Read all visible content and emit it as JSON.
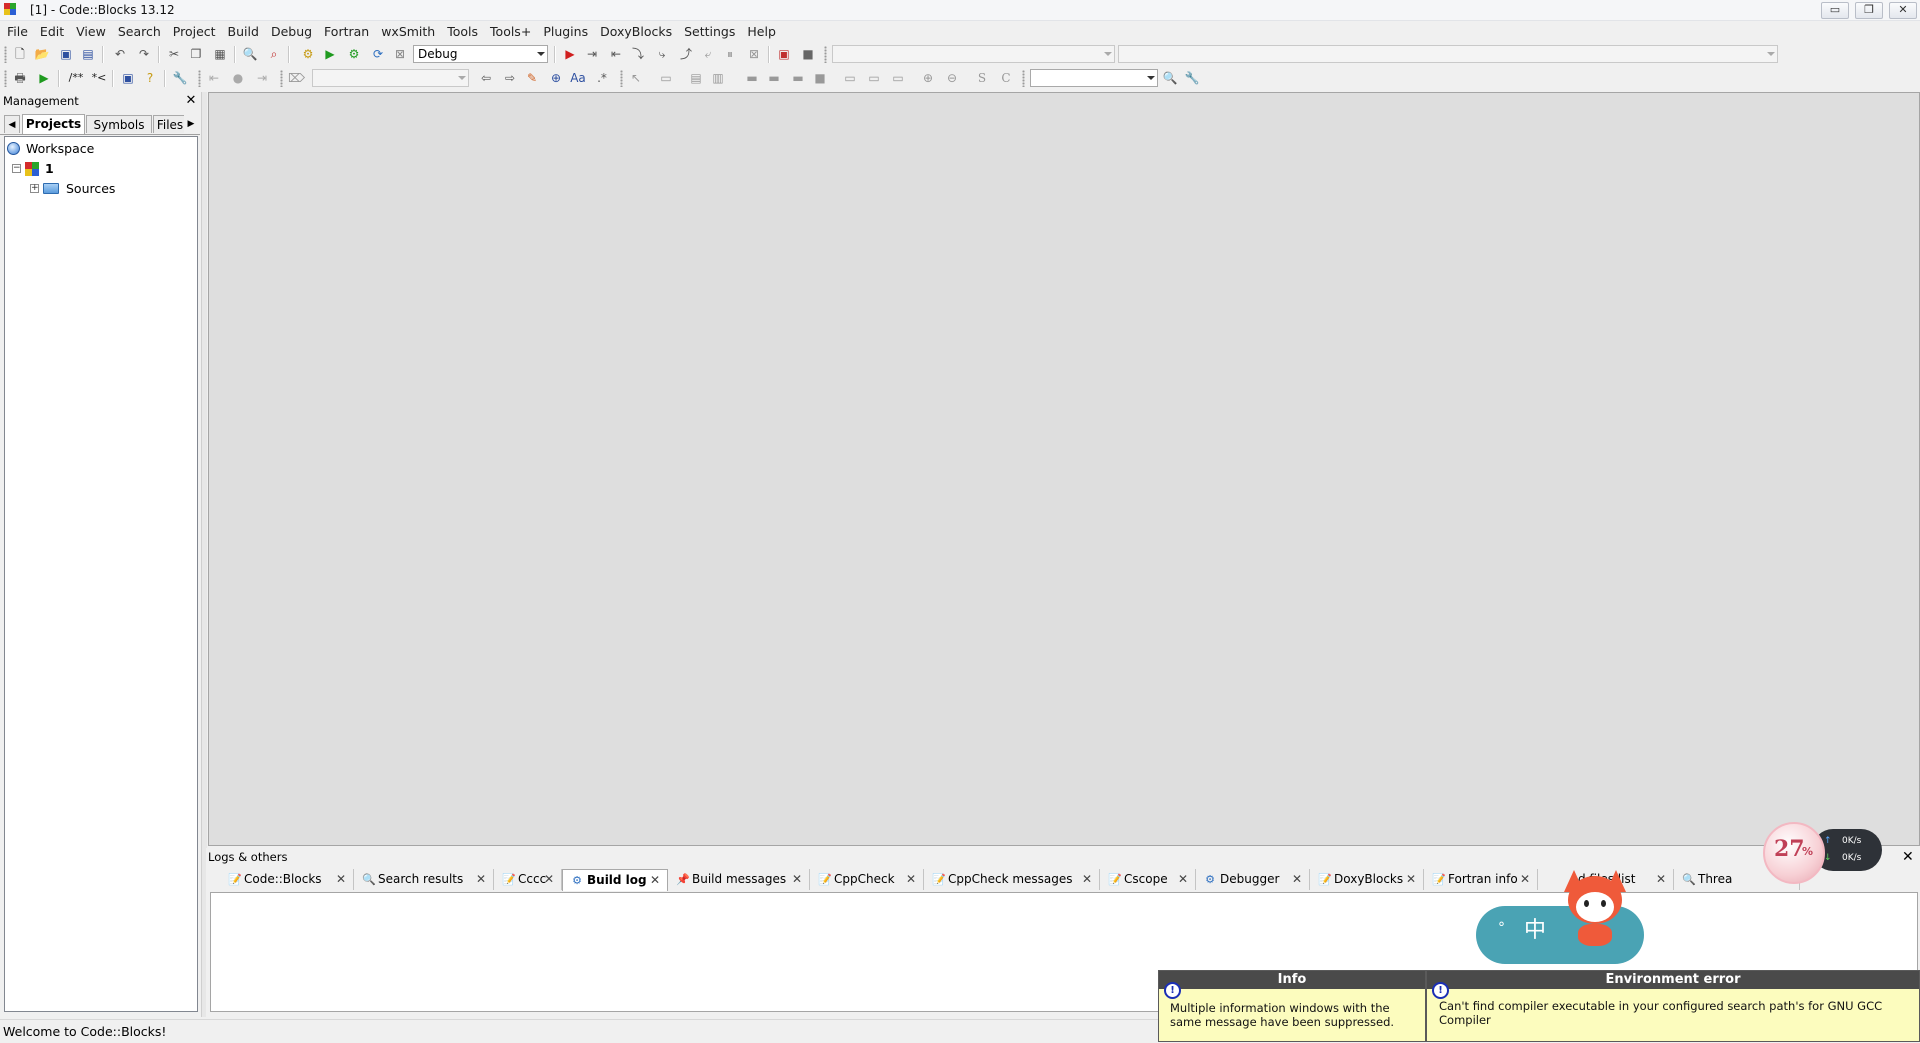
{
  "window": {
    "title": "[1] - Code::Blocks 13.12",
    "buttons": [
      "▭",
      "❐",
      "✕"
    ]
  },
  "menu": [
    "File",
    "Edit",
    "View",
    "Search",
    "Project",
    "Build",
    "Debug",
    "Fortran",
    "wxSmith",
    "Tools",
    "Tools+",
    "Plugins",
    "DoxyBlocks",
    "Settings",
    "Help"
  ],
  "toolbar": {
    "build_target": "Debug",
    "symbol_combo": "",
    "function_combo": "",
    "search_combo": "",
    "jump_combo": ""
  },
  "management": {
    "title": "Management",
    "tabs": [
      "Projects",
      "Symbols",
      "Files"
    ],
    "active_tab": "Projects",
    "tree": {
      "workspace": "Workspace",
      "project": "1",
      "folder": "Sources"
    }
  },
  "logs": {
    "title": "Logs & others",
    "tabs": [
      {
        "label": "Code::Blocks",
        "icon": "note-icon"
      },
      {
        "label": "Search results",
        "icon": "search-icon"
      },
      {
        "label": "Cccc",
        "icon": "note-icon"
      },
      {
        "label": "Build log",
        "icon": "gear-icon",
        "active": true
      },
      {
        "label": "Build messages",
        "icon": "pin-icon"
      },
      {
        "label": "CppCheck",
        "icon": "note-icon"
      },
      {
        "label": "CppCheck messages",
        "icon": "note-icon"
      },
      {
        "label": "Cscope",
        "icon": "note-icon"
      },
      {
        "label": "Debugger",
        "icon": "gear-icon"
      },
      {
        "label": "DoxyBlocks",
        "icon": "note-icon"
      },
      {
        "label": "Fortran info",
        "icon": "note-icon"
      },
      {
        "label": "d files list",
        "icon": ""
      },
      {
        "label": "Threa",
        "icon": "search-icon"
      }
    ]
  },
  "status": {
    "text": "Welcome to Code::Blocks!"
  },
  "popups": [
    {
      "title": "Info",
      "message": "Multiple information windows with the same message have been suppressed."
    },
    {
      "title": "Environment error",
      "message": "Can't find compiler executable in your configured search path's for GNU GCC Compiler"
    }
  ],
  "widgets": {
    "cpu_percent": "27",
    "percent_sign": "%",
    "upload": "0K/s",
    "download": "0K/s",
    "ime_char": "中",
    "ime_prefix": "°"
  }
}
